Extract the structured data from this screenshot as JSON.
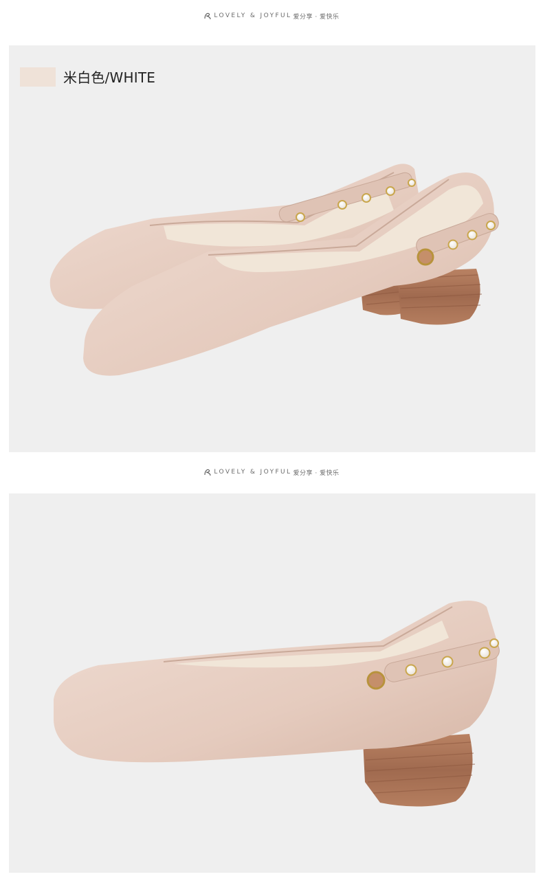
{
  "brand": {
    "text": "LOVELY & JOYFUL",
    "text_cn": "爱分享 · 爱快乐",
    "logo_icon": "flower-logo-icon"
  },
  "product": {
    "color_label": "米白色/WHITE",
    "swatch_color": "#efe2d8",
    "images": [
      {
        "icon": "shoe-pair-photo"
      },
      {
        "icon": "shoe-side-photo"
      }
    ]
  },
  "colors": {
    "panel_bg": "#efefef",
    "leather": "#e9d2c7",
    "heel_wood": "#a8745a"
  }
}
